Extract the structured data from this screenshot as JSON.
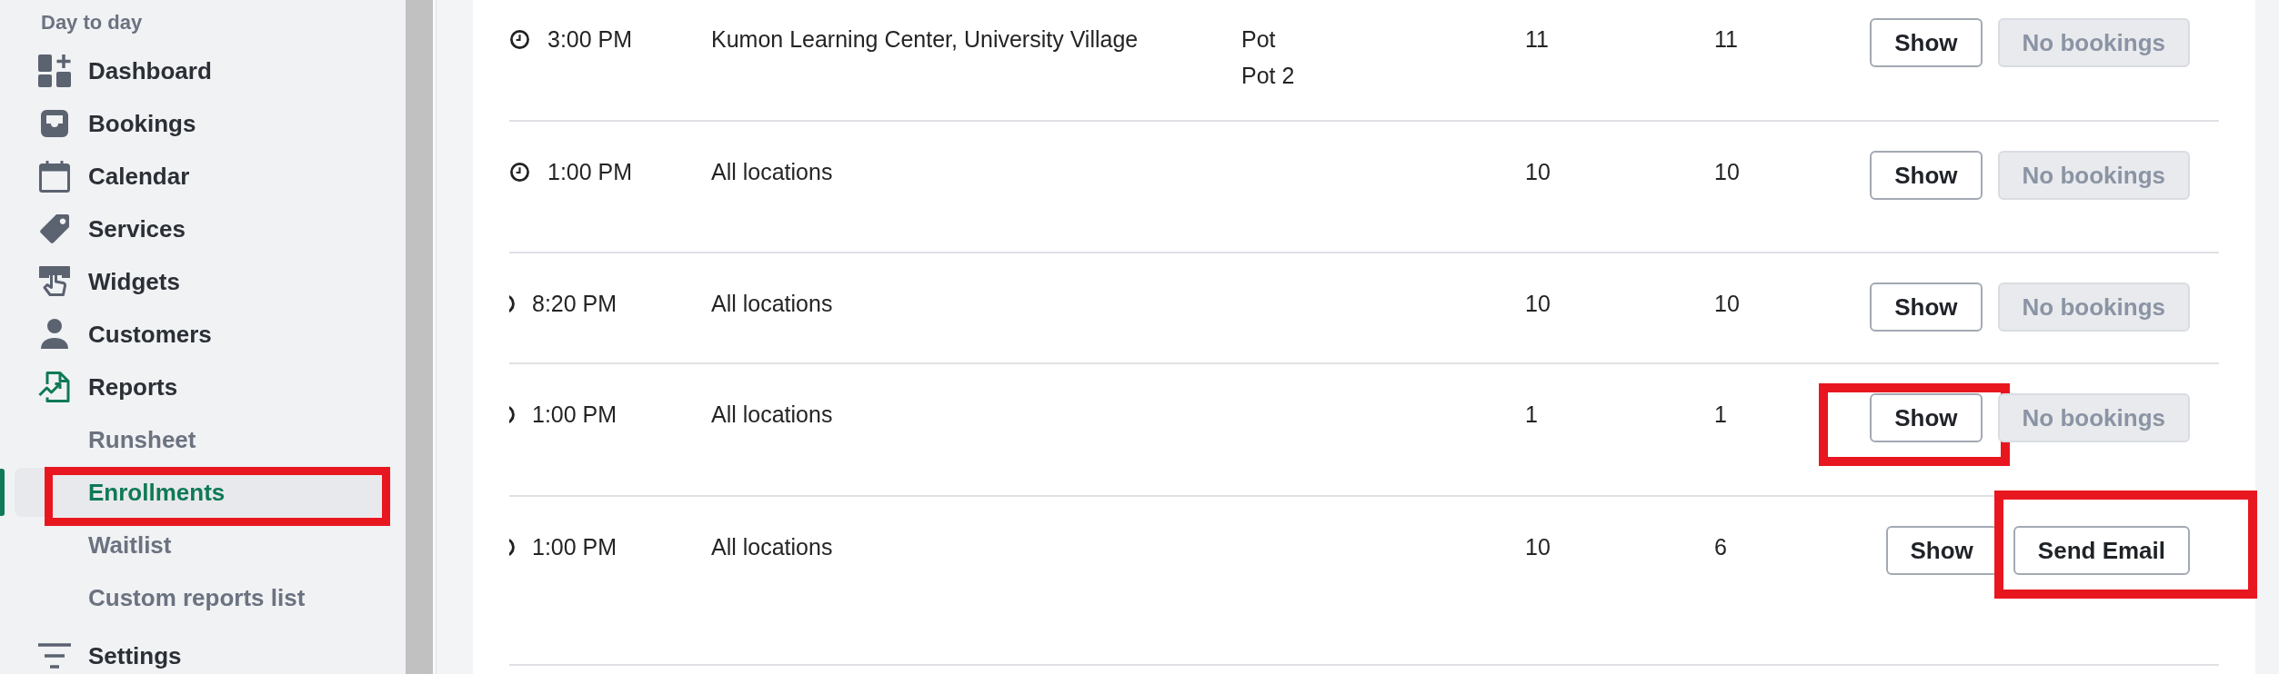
{
  "sidebar": {
    "sections": [
      {
        "label": "Day to day",
        "items": [
          {
            "label": "Dashboard",
            "selected": false
          },
          {
            "label": "Bookings",
            "selected": false
          },
          {
            "label": "Calendar",
            "selected": false
          },
          {
            "label": "Services",
            "selected": false
          },
          {
            "label": "Widgets",
            "selected": false
          },
          {
            "label": "Customers",
            "selected": false
          },
          {
            "label": "Reports",
            "selected": true,
            "children": [
              {
                "label": "Runsheet",
                "selected": false,
                "annotated": false
              },
              {
                "label": "Enrollments",
                "selected": true,
                "annotated": true
              },
              {
                "label": "Waitlist",
                "selected": false,
                "annotated": false
              },
              {
                "label": "Custom reports list",
                "selected": false,
                "annotated": false
              }
            ]
          }
        ]
      },
      {
        "items": [
          {
            "label": "Settings",
            "selected": false
          }
        ]
      }
    ]
  },
  "table": {
    "rows": [
      {
        "icon_clipped": false,
        "column_1": "3:00 PM",
        "column_2": "Kumon Learning Center, University Village",
        "column_3": [
          "Pot",
          "Pot 2"
        ],
        "column_4": "11",
        "column_5": "11",
        "actions": [
          {
            "label": "Show",
            "disabled": false,
            "annotated": false
          },
          {
            "label": "No bookings",
            "disabled": true,
            "annotated": false
          }
        ]
      },
      {
        "icon_clipped": false,
        "column_1": "1:00 PM",
        "column_2": "All locations",
        "column_4": "10",
        "column_5": "10",
        "actions": [
          {
            "label": "Show",
            "disabled": false,
            "annotated": false
          },
          {
            "label": "No bookings",
            "disabled": true,
            "annotated": false
          }
        ]
      },
      {
        "icon_clipped": true,
        "column_1": "8:20 PM",
        "column_2": "All locations",
        "column_4": "10",
        "column_5": "10",
        "actions": [
          {
            "label": "Show",
            "disabled": false,
            "annotated": false
          },
          {
            "label": "No bookings",
            "disabled": true,
            "annotated": false
          }
        ]
      },
      {
        "icon_clipped": true,
        "column_1": "1:00 PM",
        "column_2": "All locations",
        "column_4": "1",
        "column_5": "1",
        "actions": [
          {
            "label": "Show",
            "disabled": false,
            "annotated": true
          },
          {
            "label": "No bookings",
            "disabled": true,
            "annotated": false
          }
        ]
      },
      {
        "icon_clipped": true,
        "column_1": "1:00 PM",
        "column_2": "All locations",
        "column_4": "10",
        "column_5": "6",
        "actions": [
          {
            "label": "Show",
            "disabled": false,
            "annotated": false
          },
          {
            "label": "Send Email",
            "disabled": false,
            "annotated": true
          }
        ]
      }
    ]
  }
}
